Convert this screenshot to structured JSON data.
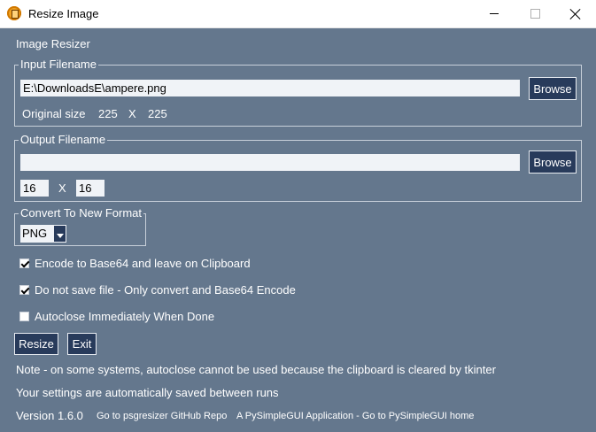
{
  "window": {
    "title": "Resize Image"
  },
  "heading": "Image Resizer",
  "input_frame": {
    "title": "Input Filename",
    "filename": "E:\\DownloadsE\\ampere.png",
    "browse": "Browse",
    "original_size_label": "Original size",
    "width": "225",
    "x": "X",
    "height": "225"
  },
  "output_frame": {
    "title": "Output Filename",
    "filename": "",
    "browse": "Browse",
    "width": "16",
    "x": "X",
    "height": "16"
  },
  "format_frame": {
    "title": "Convert To New Format",
    "selected": "PNG"
  },
  "options": [
    {
      "label": "Encode to Base64 and leave on Clipboard",
      "checked": true
    },
    {
      "label": "Do not save file - Only convert and Base64 Encode",
      "checked": true
    },
    {
      "label": "Autoclose Immediately When Done",
      "checked": false
    }
  ],
  "buttons": {
    "resize": "Resize",
    "exit": "Exit"
  },
  "notes": {
    "line1": "Note - on some systems, autoclose cannot be used because the clipboard is cleared by tkinter",
    "line2": "Your settings are automatically saved between runs"
  },
  "footer": {
    "version": "Version 1.6.0",
    "repo_link": "Go to psgresizer GitHub Repo",
    "home_link": "A PySimpleGUI Application - Go to PySimpleGUI home"
  }
}
